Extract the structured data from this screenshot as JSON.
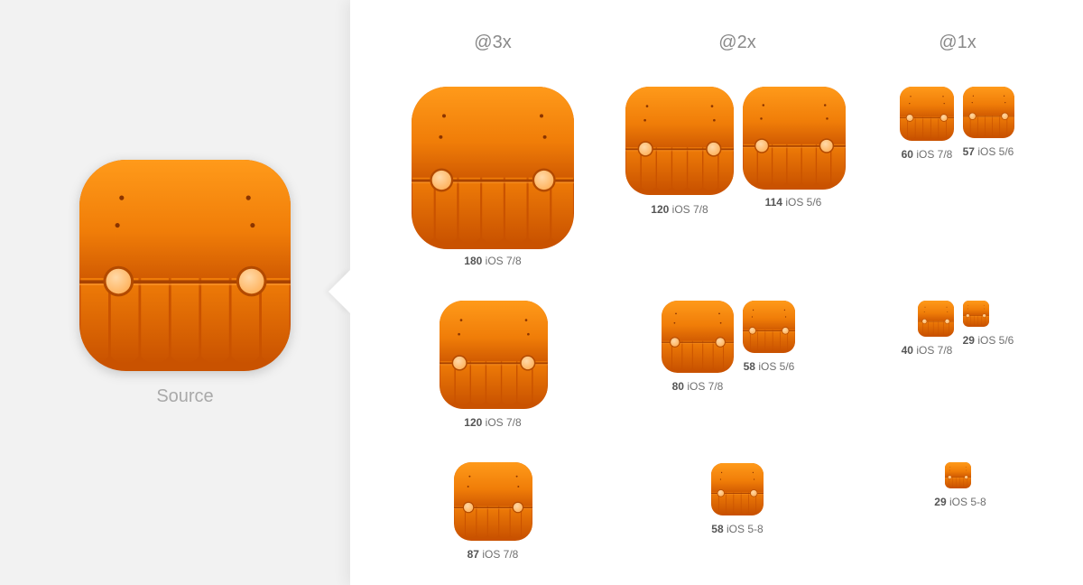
{
  "colors": {
    "icon_top": "#ff9a1a",
    "icon_mid": "#f07d08",
    "icon_bottom": "#c95200",
    "band": "#a84200",
    "button": "#ffb15a",
    "button_ring": "#b34a00",
    "hole": "#8a3400"
  },
  "icon_symbol": "orange-octopus-app-icon",
  "source": {
    "label": "Source"
  },
  "columns": [
    {
      "label": "@3x"
    },
    {
      "label": "@2x"
    },
    {
      "label": "@1x"
    }
  ],
  "variants": [
    {
      "size": "180",
      "label": "iOS 7/8"
    },
    {
      "size": "120",
      "label": "iOS 7/8"
    },
    {
      "size": "87",
      "label": "iOS 7/8"
    },
    {
      "size": "120",
      "label": "iOS 7/8"
    },
    {
      "size": "114",
      "label": "iOS 5/6"
    },
    {
      "size": "80",
      "label": "iOS 7/8"
    },
    {
      "size": "58",
      "label": "iOS 5/6"
    },
    {
      "size": "58",
      "label": "iOS 5-8"
    },
    {
      "size": "60",
      "label": "iOS 7/8"
    },
    {
      "size": "57",
      "label": "iOS 5/6"
    },
    {
      "size": "40",
      "label": "iOS 7/8"
    },
    {
      "size": "29",
      "label": "iOS 5/6"
    },
    {
      "size": "29",
      "label": "iOS 5-8"
    }
  ]
}
